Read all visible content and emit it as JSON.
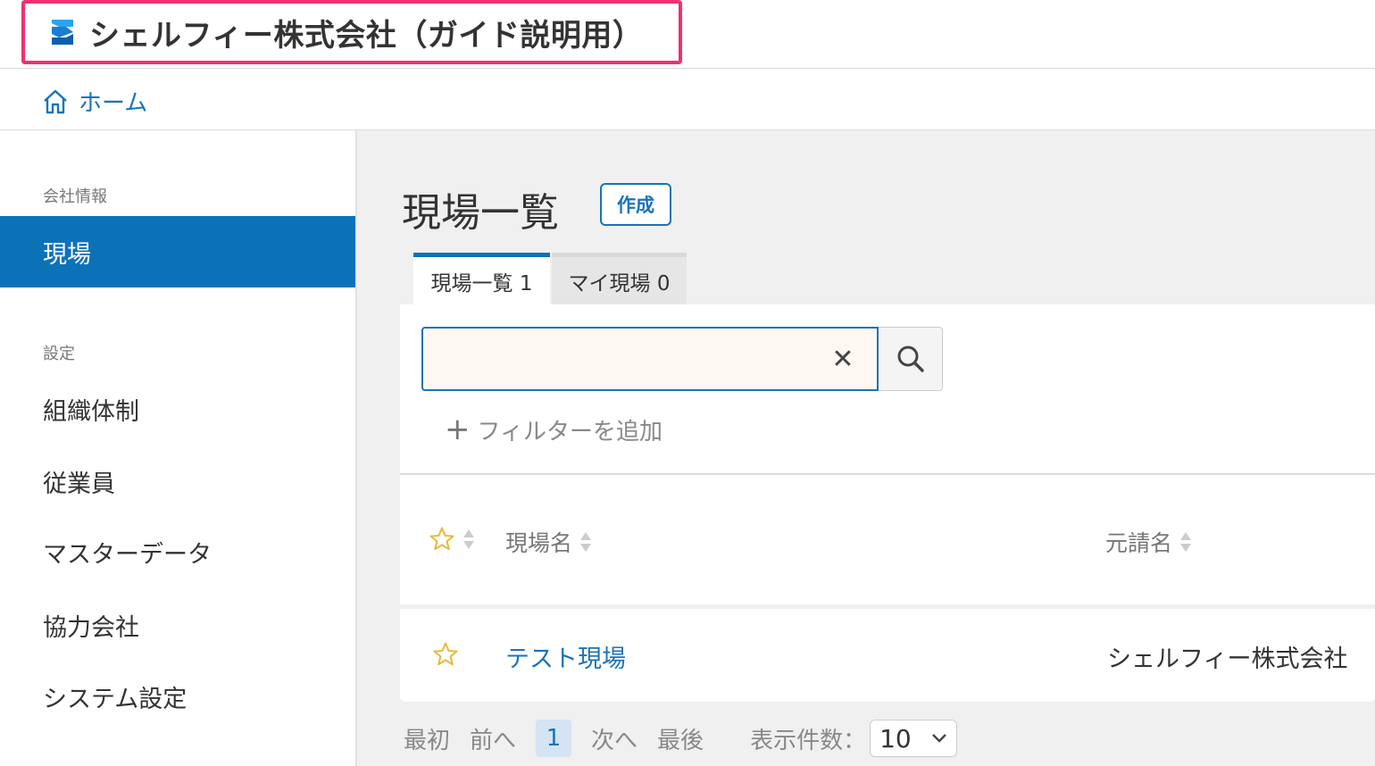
{
  "header": {
    "company_name": "シェルフィー株式会社（ガイド説明用）",
    "logo_color": "#1a8fe0",
    "highlight_color": "#f0306f"
  },
  "breadcrumb": {
    "home_label": "ホーム"
  },
  "sidebar": {
    "section_company": "会社情報",
    "item_sites": "現場",
    "section_settings": "設定",
    "items": [
      "組織体制",
      "従業員",
      "マスターデータ",
      "協力会社",
      "システム設定"
    ]
  },
  "main": {
    "title": "現場一覧",
    "create_label": "作成",
    "tabs": [
      {
        "label": "現場一覧 1",
        "active": true
      },
      {
        "label": "マイ現場 0",
        "active": false
      }
    ],
    "search": {
      "value": "",
      "placeholder": "",
      "clear_icon": "close-icon",
      "search_icon": "search-icon"
    },
    "add_filter_label": "フィルターを追加",
    "table": {
      "columns": [
        "現場名",
        "元請名"
      ],
      "rows": [
        {
          "name": "テスト現場",
          "contractor": "シェルフィー株式会社",
          "starred": false
        }
      ]
    },
    "pager": {
      "first": "最初",
      "prev": "前へ",
      "current_page": "1",
      "next": "次へ",
      "last": "最後",
      "per_page_label": "表示件数：",
      "per_page_value": "10"
    }
  },
  "colors": {
    "accent": "#0c72b8",
    "link": "#1a73b8",
    "star": "#e8b93a"
  }
}
